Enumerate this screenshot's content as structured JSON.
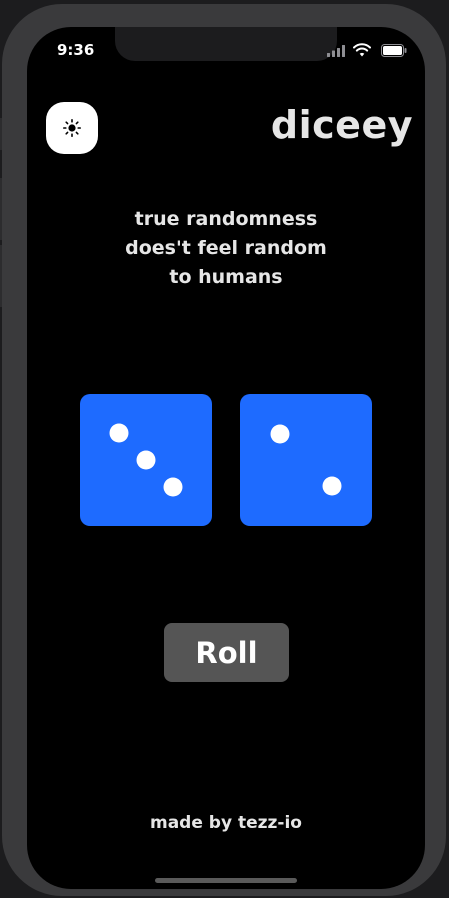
{
  "status_bar": {
    "time": "9:36",
    "icons": [
      "cellular-signal-icon",
      "wifi-icon",
      "battery-icon"
    ]
  },
  "header": {
    "theme_toggle_icon": "sun-icon",
    "app_title": "diceey"
  },
  "tagline": {
    "lines": [
      "true randomness",
      "does't feel random",
      "to humans"
    ]
  },
  "dice": [
    {
      "value": 3
    },
    {
      "value": 2
    }
  ],
  "roll_button": {
    "label": "Roll"
  },
  "footer": {
    "credit": "made by tezz-io"
  },
  "colors": {
    "background": "#000000",
    "die": "#1e6bff",
    "pip": "#ffffff",
    "button": "#555555",
    "text": "#e6e6e6"
  }
}
